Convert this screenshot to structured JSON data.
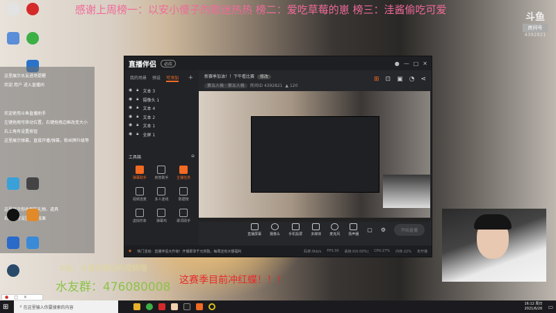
{
  "overlay": {
    "banner": "感谢上周榜一：以安小傻子的歌迷热热 榜二：爱吃草莓的崽 榜三：洼酱偷吃可爱",
    "douyu_logo": "斗鱼",
    "room_label": "房间号",
    "room_number": "4392821",
    "bilibili": "b站：斗鱼你瑶Q的视频哦",
    "qq_group": "水友群：476080008",
    "season_goal": "这赛季目前冲红蝶！！！"
  },
  "chat": {
    "lines": [
      "这里展示水友进场提醒",
      "欢迎 用户 进入直播间",
      "欢迎使用斗鱼直播助手",
      "左键拖拽可移动位置，右键拖拽边框改变大小",
      "右上角有设置按钮",
      "这里展示弹幕，直接开播/弹幕，粉丝牌升级等",
      "这里展示你收到的礼物、道具",
      "右上角可设置礼物效果"
    ]
  },
  "app": {
    "brand": "直播伴侣",
    "version": "必应",
    "window_controls": [
      "—",
      "□",
      "✕"
    ],
    "tabs": [
      "我的场景",
      "预设",
      "可添加"
    ],
    "add": "+",
    "layers": [
      "文本 3",
      "摄像头 1",
      "文本 4",
      "文本 2",
      "文本 1",
      "全屏 1"
    ],
    "toolbox_title": "工具箱",
    "tools": [
      {
        "label": "弹幕助手",
        "active": true
      },
      {
        "label": "房管助手",
        "active": false
      },
      {
        "label": "主播任务",
        "active": true
      },
      {
        "label": "视频连麦",
        "active": false
      },
      {
        "label": "多人连线",
        "active": false
      },
      {
        "label": "数据榜",
        "active": false
      },
      {
        "label": "虚拟形象",
        "active": false
      },
      {
        "label": "弹幕鸡",
        "active": false
      },
      {
        "label": "歌词助手",
        "active": false
      }
    ],
    "stream_title": "新赛季加油！！下午看比赛",
    "edit_tag": "修改",
    "category": "第五人格 · 第五人格",
    "room_id_label": "房间ID 4392821",
    "viewers": "120",
    "controls": [
      "直播屏幕",
      "摄像头",
      "手机投屏",
      "多媒体",
      "麦克风",
      "扬声器"
    ],
    "start_button": "开始直播",
    "notice": "热门活动：直播伴侣大升级！开播即享千元奖励，每周还有大额福利",
    "stats": [
      "码率:0kb/s",
      "FPS:30",
      "丢帧:0(0.00%)",
      "CPU:27%",
      "内存:22%",
      "未开播"
    ]
  },
  "mini_window": {
    "close": "✕",
    "restore": "▢"
  },
  "taskbar": {
    "search_placeholder": "在这里输入你要搜索的内容",
    "time": "16:12 周日",
    "date": "2021/6/26"
  }
}
